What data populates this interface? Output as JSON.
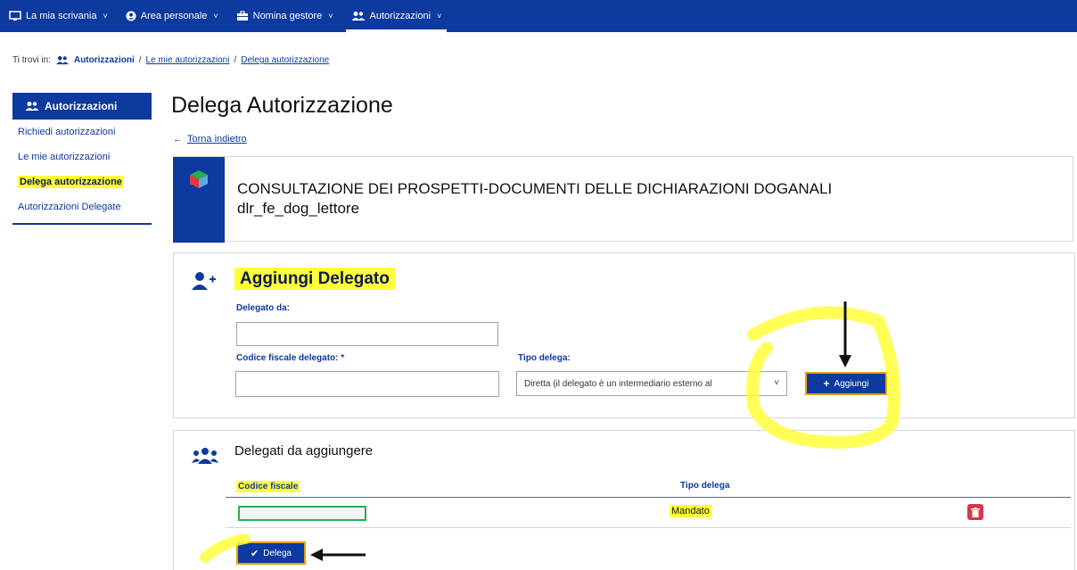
{
  "topnav": {
    "items": [
      {
        "label": "La mia scrivania",
        "icon": "monitor-icon"
      },
      {
        "label": "Area personale",
        "icon": "user-circle-icon"
      },
      {
        "label": "Nomina gestore",
        "icon": "briefcase-icon"
      },
      {
        "label": "Autorizzazioni",
        "icon": "users-icon"
      }
    ],
    "active_index": 3,
    "chevron": "˅"
  },
  "breadcrumb": {
    "prefix": "Ti trovi in:",
    "items": [
      "Autorizzazioni",
      "Le mie autorizzazioni",
      "Delega autorizzazione"
    ],
    "separator": "/"
  },
  "sidebar": {
    "title": "Autorizzazioni",
    "items": [
      {
        "label": "Richiedi autorizzazioni"
      },
      {
        "label": "Le mie autorizzazioni"
      },
      {
        "label": "Delega autorizzazione",
        "active": true
      },
      {
        "label": "Autorizzazioni Delegate"
      }
    ]
  },
  "main": {
    "title": "Delega Autorizzazione",
    "back_label": "Torna indietro",
    "card": {
      "line1": "CONSULTAZIONE DEI PROSPETTI-DOCUMENTI DELLE DICHIARAZIONI DOGANALI",
      "line2": "dlr_fe_dog_lettore"
    },
    "add_section": {
      "title": "Aggiungi Delegato",
      "delegato_da_label": "Delegato da:",
      "delegato_da_value": "",
      "cf_label": "Codice fiscale delegato: *",
      "cf_value": "",
      "tipo_label": "Tipo delega:",
      "tipo_value": "Diretta (il delegato è un intermediario esterno al",
      "add_button": "Aggiungi"
    },
    "list_section": {
      "title": "Delegati da aggiungere",
      "col_cf": "Codice fiscale",
      "col_tipo": "Tipo delega",
      "rows": [
        {
          "cf": "",
          "tipo": "Mandato"
        }
      ],
      "delega_button": "Delega"
    }
  },
  "colors": {
    "primary": "#0d3a9e",
    "highlight": "#ffff3a",
    "danger": "#d9364a",
    "cf_border": "#2ab04a"
  }
}
